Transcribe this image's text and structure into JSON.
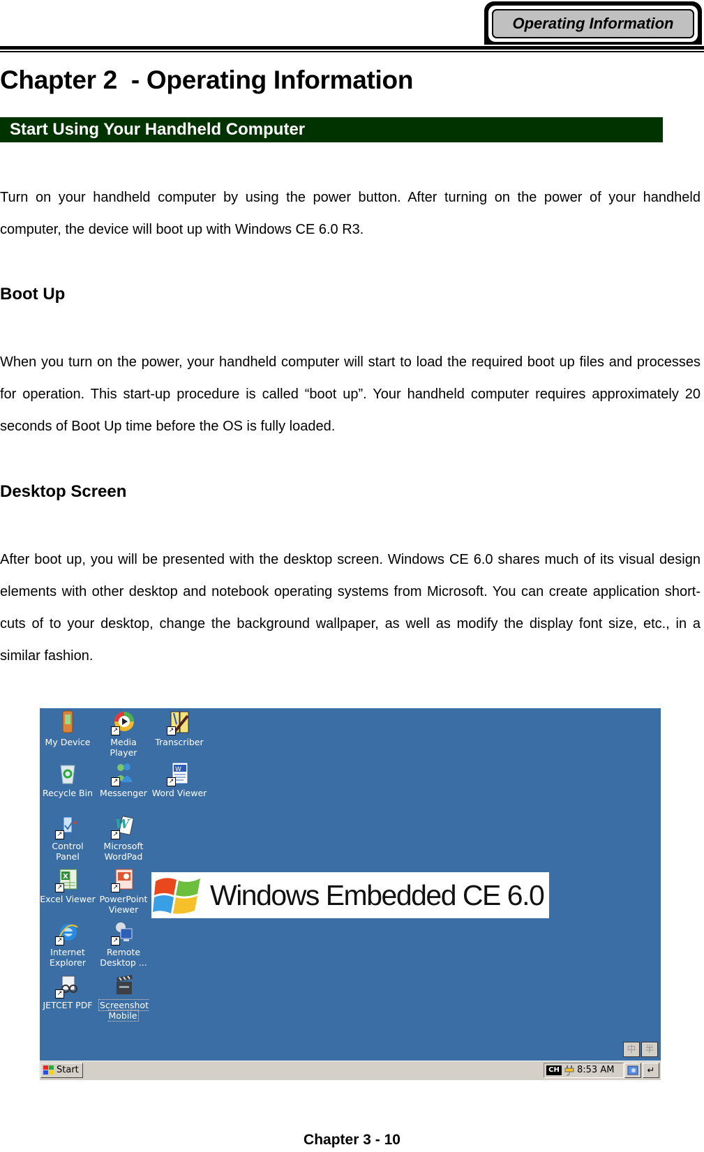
{
  "header": {
    "tab_label": "Operating Information"
  },
  "chapter_title": "Chapter 2  - Operating Information",
  "section_heading": "Start Using Your Handheld Computer",
  "intro_paragraph": "Turn on your handheld computer by using the power button. After turning on the power of your handheld computer, the device will boot up with Windows CE 6.0 R3.",
  "boot_up": {
    "heading": "Boot Up",
    "paragraph": "When you turn on the power, your handheld computer will start to load the required boot up files and processes for operation. This start-up procedure is called “boot up”. Your handheld computer requires approximately 20 seconds of Boot Up time before the OS is fully loaded."
  },
  "desktop_screen": {
    "heading": "Desktop Screen",
    "paragraph": "After boot up, you will be presented with the desktop screen. Windows CE 6.0 shares much of its visual design elements with other desktop and notebook operating systems from Microsoft. You can create application short-cuts of to your desktop, change the background wallpaper, as well as modify the display font size, etc., in a similar fashion."
  },
  "screenshot": {
    "desktop_color": "#3a6ea5",
    "icons": [
      {
        "label": "My Device",
        "icon": "my-device-icon",
        "shortcut": false
      },
      {
        "label": "Media Player",
        "icon": "media-player-icon",
        "shortcut": true
      },
      {
        "label": "Transcriber",
        "icon": "transcriber-icon",
        "shortcut": true
      },
      {
        "label": "Recycle Bin",
        "icon": "recycle-bin-icon",
        "shortcut": false
      },
      {
        "label": "Messenger",
        "icon": "messenger-icon",
        "shortcut": true
      },
      {
        "label": "Word Viewer",
        "icon": "word-viewer-icon",
        "shortcut": true
      },
      {
        "label": "Control Panel",
        "icon": "control-panel-icon",
        "shortcut": true
      },
      {
        "label": "Microsoft WordPad",
        "icon": "wordpad-icon",
        "shortcut": true
      },
      {
        "label": "Excel Viewer",
        "icon": "excel-viewer-icon",
        "shortcut": true
      },
      {
        "label": "PowerPoint Viewer",
        "icon": "powerpoint-viewer-icon",
        "shortcut": true
      },
      {
        "label": "Internet Explorer",
        "icon": "internet-explorer-icon",
        "shortcut": true
      },
      {
        "label": "Remote Desktop ...",
        "icon": "remote-desktop-icon",
        "shortcut": true
      },
      {
        "label": "JETCET PDF",
        "icon": "jetcet-pdf-icon",
        "shortcut": true
      },
      {
        "label": "Screenshot Mobile",
        "icon": "screenshot-mobile-icon",
        "shortcut": false
      }
    ],
    "banner_text": "Windows Embedded CE 6.0",
    "ime_buttons": [
      "中",
      "半"
    ],
    "taskbar": {
      "start_label": "Start",
      "input_indicator": "CH",
      "clock": "8:53 AM",
      "desktop_glyph": "↵"
    }
  },
  "footer": {
    "page_label": "Chapter 3 - 10"
  }
}
